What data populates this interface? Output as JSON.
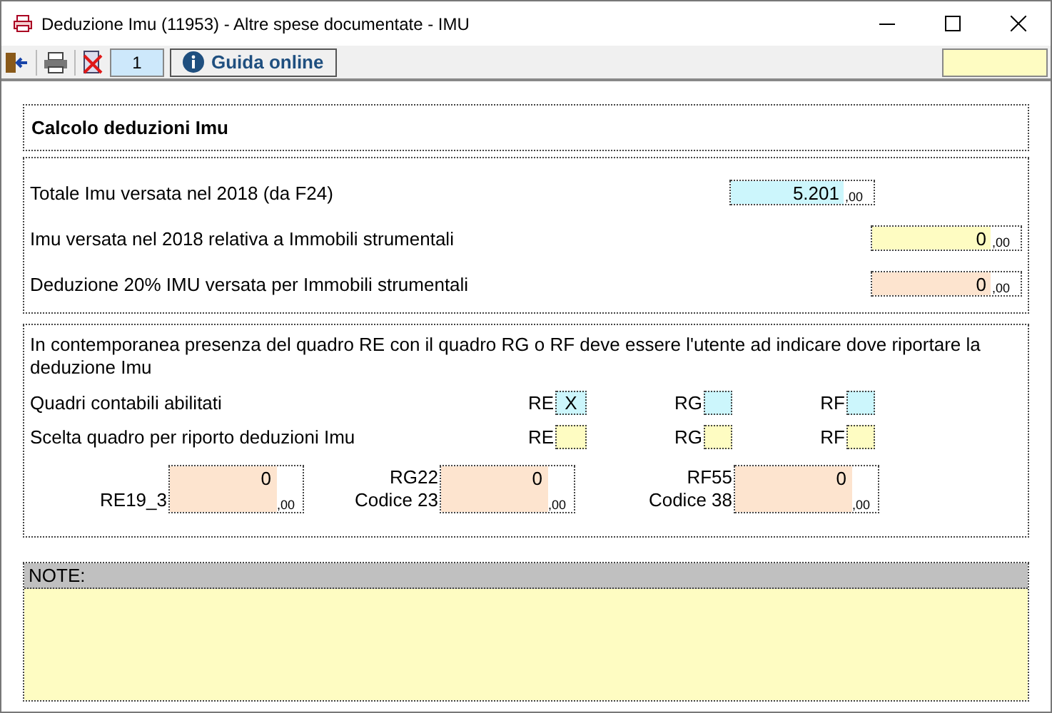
{
  "window": {
    "title": "Deduzione Imu (11953) - Altre spese documentate - IMU"
  },
  "toolbar": {
    "page": "1",
    "help_button": "Guida online"
  },
  "header": {
    "title": "Calcolo deduzioni Imu"
  },
  "amounts": [
    {
      "label": "Totale Imu versata nel 2018 (da F24)",
      "value": "5.201",
      "decimals": ",00",
      "color": "#ccf6fc"
    },
    {
      "label": "Imu versata nel 2018 relativa a Immobili strumentali",
      "value": "0",
      "decimals": ",00",
      "color": "#fefcc2"
    },
    {
      "label": "Deduzione 20% IMU versata per Immobili strumentali",
      "value": "0",
      "decimals": ",00",
      "color": "#fde4cf"
    }
  ],
  "quadri": {
    "note": "In contemporanea presenza del quadro RE con il quadro RG o RF deve essere l'utente ad indicare dove riportare la deduzione Imu",
    "rows": [
      {
        "label": "Quadri contabili abilitati",
        "color": "#ccf6fc",
        "boxes": [
          {
            "label": "RE",
            "value": "X"
          },
          {
            "label": "RG"
          },
          {
            "label": "RF"
          }
        ]
      },
      {
        "label": "Scelta quadro per riporto deduzioni Imu",
        "color": "#fefcc2",
        "boxes": [
          {
            "label": "RE"
          },
          {
            "label": "RG"
          },
          {
            "label": "RF"
          }
        ]
      }
    ],
    "fields": [
      {
        "lines": [
          "RE19_3"
        ],
        "value": "0",
        "decimals": ",00",
        "color": "#fde4cf"
      },
      {
        "lines": [
          "RG22",
          "Codice 23"
        ],
        "value": "0",
        "decimals": ",00",
        "color": "#fde4cf"
      },
      {
        "lines": [
          "RF55",
          "Codice 38"
        ],
        "value": "0",
        "decimals": ",00",
        "color": "#fde4cf"
      }
    ]
  },
  "notes": {
    "label": "NOTE:"
  }
}
